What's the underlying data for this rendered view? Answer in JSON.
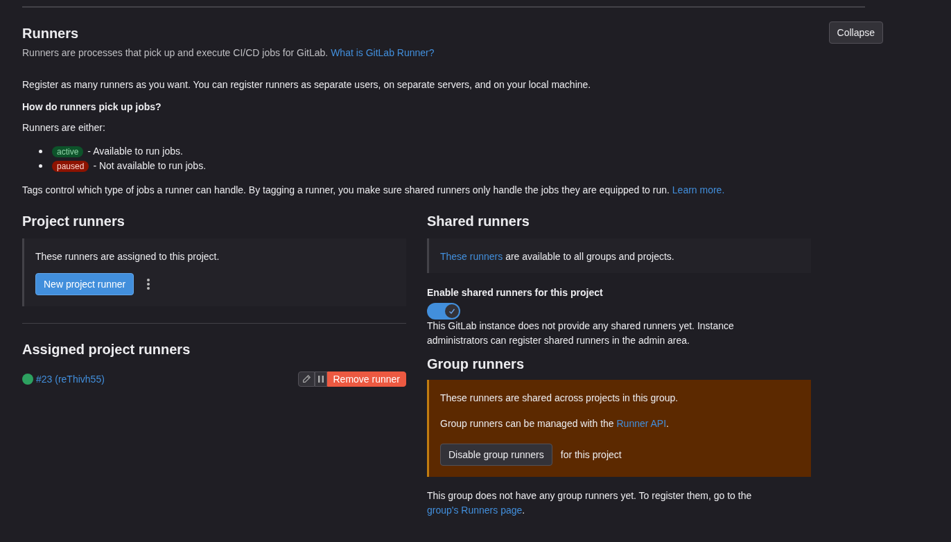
{
  "header": {
    "title": "Runners",
    "collapse_button": "Collapse"
  },
  "intro": [
    {
      "kind": "text",
      "text": "Runners are processes that pick up and execute CI/CD jobs for GitLab. "
    },
    {
      "kind": "link",
      "text": "What is GitLab Runner?"
    }
  ],
  "register_text": "Register as many runners as you want. You can register runners as separate users, on separate servers, and on your local machine.",
  "question": "How do runners pick up jobs?",
  "either_text": "Runners are either:",
  "states": [
    {
      "badge": "active",
      "kind": "active",
      "description": "- Available to run jobs."
    },
    {
      "badge": "paused",
      "kind": "paused",
      "description": "- Not available to run jobs."
    }
  ],
  "tags_text": [
    {
      "kind": "text",
      "text": "Tags control which type of jobs a runner can handle. By tagging a runner, you make sure shared runners only handle the jobs they are equipped to run. "
    },
    {
      "kind": "link",
      "text": "Learn more."
    }
  ],
  "project_runners": {
    "title": "Project runners",
    "note": "These runners are assigned to this project.",
    "new_button": "New project runner"
  },
  "assigned": {
    "title": "Assigned project runners",
    "runners": [
      {
        "name": "#23 (reThivh55)",
        "color": "#2da160",
        "remove_button": "Remove runner"
      }
    ]
  },
  "shared_runners": {
    "title": "Shared runners",
    "note": [
      {
        "kind": "link",
        "text": "These runners"
      },
      {
        "kind": "text",
        "text": " are available to all groups and projects."
      }
    ],
    "toggle_label": "Enable shared runners for this project",
    "toggle_on": true,
    "info": "This GitLab instance does not provide any shared runners yet. Instance administrators can register shared runners in the admin area."
  },
  "group_runners": {
    "title": "Group runners",
    "note": "These runners are shared across projects in this group.",
    "api_text": [
      {
        "kind": "text",
        "text": "Group runners can be managed with the "
      },
      {
        "kind": "link",
        "text": "Runner API"
      },
      {
        "kind": "text",
        "text": "."
      }
    ],
    "disable_button": "Disable group runners",
    "disable_suffix": "for this project",
    "footer": [
      {
        "kind": "text",
        "text": "This group does not have any group runners yet. To register them, go to the "
      },
      {
        "kind": "link",
        "text": "group's Runners page"
      },
      {
        "kind": "text",
        "text": "."
      }
    ]
  }
}
